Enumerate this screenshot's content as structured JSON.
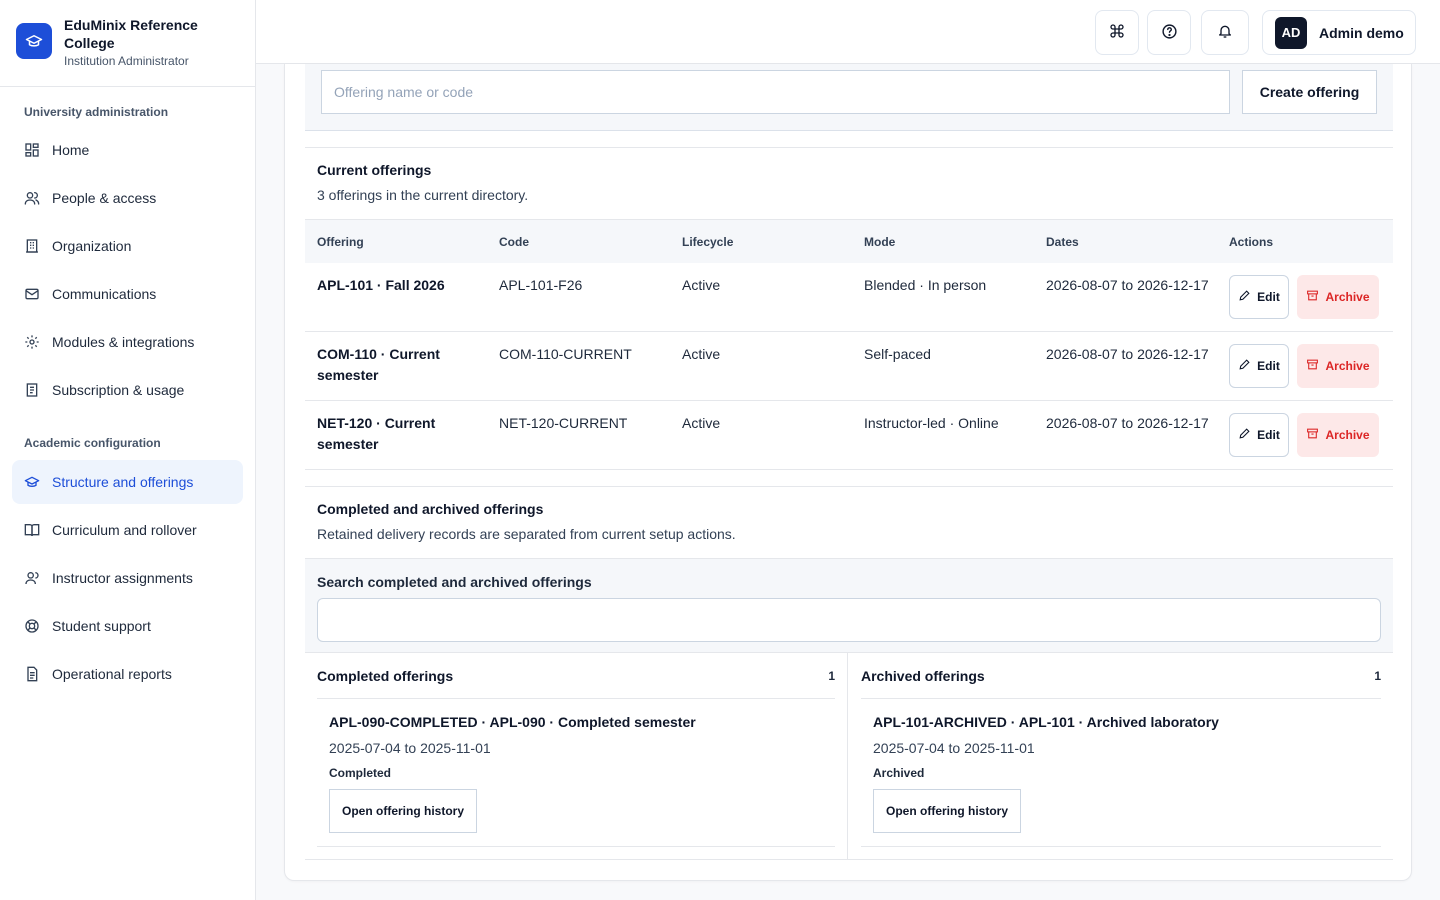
{
  "brand": {
    "name": "EduMinix Reference College",
    "role": "Institution Administrator"
  },
  "nav": {
    "section1": "University administration",
    "section2": "Academic configuration",
    "items": [
      {
        "label": "Home",
        "icon": "grid-icon"
      },
      {
        "label": "People & access",
        "icon": "users-icon"
      },
      {
        "label": "Organization",
        "icon": "building-icon"
      },
      {
        "label": "Communications",
        "icon": "mail-icon"
      },
      {
        "label": "Modules & integrations",
        "icon": "gear-icon"
      },
      {
        "label": "Subscription & usage",
        "icon": "receipt-icon"
      },
      {
        "label": "Structure and offerings",
        "icon": "graduation-cap-icon",
        "active": true
      },
      {
        "label": "Curriculum and rollover",
        "icon": "book-icon"
      },
      {
        "label": "Instructor assignments",
        "icon": "user-icon"
      },
      {
        "label": "Student support",
        "icon": "lifebuoy-icon"
      },
      {
        "label": "Operational reports",
        "icon": "document-icon"
      }
    ]
  },
  "topbar": {
    "avatar": "AD",
    "user": "Admin demo"
  },
  "offering_search": {
    "placeholder": "Offering name or code",
    "create_label": "Create offering"
  },
  "current": {
    "title": "Current offerings",
    "subtitle": "3 offerings in the current directory.",
    "columns": [
      "Offering",
      "Code",
      "Lifecycle",
      "Mode",
      "Dates",
      "Actions"
    ],
    "rows": [
      {
        "offering": "APL-101 · Fall 2026",
        "code": "APL-101-F26",
        "lifecycle": "Active",
        "mode": "Blended · In person",
        "dates": "2026-08-07 to 2026-12-17"
      },
      {
        "offering": "COM-110 · Current semester",
        "code": "COM-110-CURRENT",
        "lifecycle": "Active",
        "mode": "Self-paced",
        "dates": "2026-08-07 to 2026-12-17"
      },
      {
        "offering": "NET-120 · Current semester",
        "code": "NET-120-CURRENT",
        "lifecycle": "Active",
        "mode": "Instructor-led · Online",
        "dates": "2026-08-07 to 2026-12-17"
      }
    ],
    "edit_label": "Edit",
    "archive_label": "Archive"
  },
  "retained": {
    "title": "Completed and archived offerings",
    "subtitle": "Retained delivery records are separated from current setup actions.",
    "search_label": "Search completed and archived offerings",
    "search_value": ""
  },
  "completed": {
    "title": "Completed offerings",
    "count": "1",
    "entry": {
      "title": "APL-090-COMPLETED · APL-090 · Completed semester",
      "dates": "2025-07-04 to 2025-11-01",
      "status": "Completed",
      "button": "Open offering history"
    }
  },
  "archived": {
    "title": "Archived offerings",
    "count": "1",
    "entry": {
      "title": "APL-101-ARCHIVED · APL-101 · Archived laboratory",
      "dates": "2025-07-04 to 2025-11-01",
      "status": "Archived",
      "button": "Open offering history"
    }
  },
  "colors": {
    "accent": "#1d4ed8",
    "active_nav_bg": "#eef4fd",
    "danger": "#dc2626",
    "danger_bg": "#fde8e8"
  }
}
